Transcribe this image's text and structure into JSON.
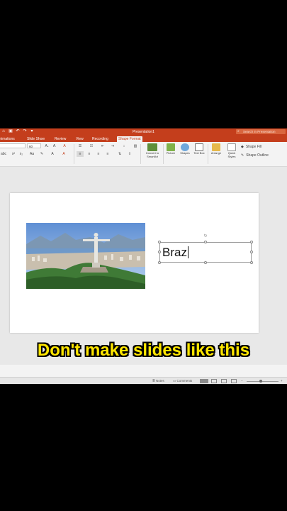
{
  "window": {
    "title": "Presentation1",
    "search_placeholder": "Search in Presentation"
  },
  "tabs": [
    {
      "label": "Animations"
    },
    {
      "label": "Slide Show"
    },
    {
      "label": "Review"
    },
    {
      "label": "View"
    },
    {
      "label": "Recording"
    },
    {
      "label": "Shape Format",
      "active": true
    }
  ],
  "ribbon": {
    "font_size": "60",
    "convert_smartart": "Convert to SmartArt",
    "picture": "Picture",
    "shapes": "Shapes",
    "text_box": "Text Box",
    "arrange": "Arrange",
    "quick_styles": "Quick Styles",
    "shape_fill": "Shape Fill",
    "shape_outline": "Shape Outline"
  },
  "slide": {
    "textbox_text": "Braz",
    "photo_icon": "christ-the-redeemer-photo"
  },
  "caption": "Don't make slides like this",
  "status": {
    "notes": "Notes",
    "comments": "Comments"
  },
  "colors": {
    "brand": "#c43e1c",
    "caption_fill": "#ffe600"
  }
}
